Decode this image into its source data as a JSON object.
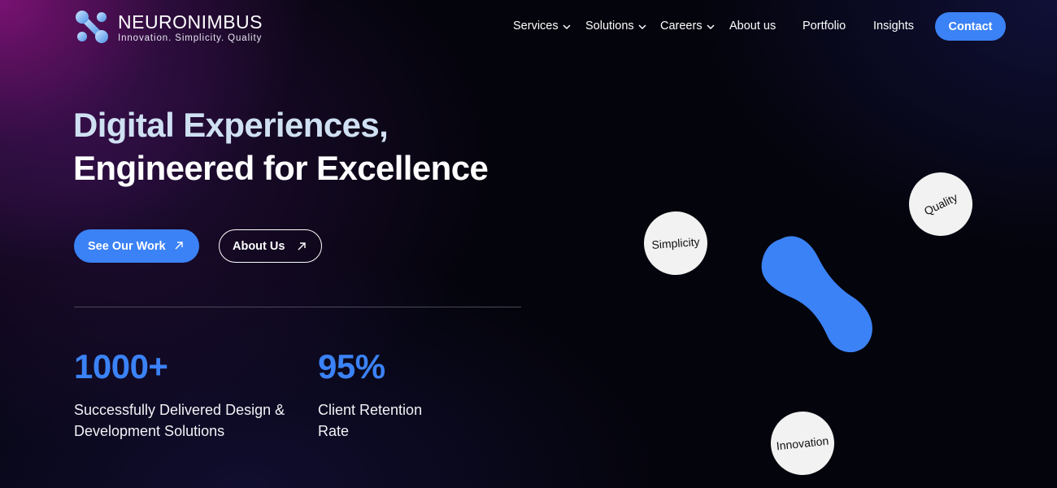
{
  "brand": {
    "name": "NEURONIMBUS",
    "tagline": "Innovation. Simplicity. Quality"
  },
  "nav": {
    "items": [
      {
        "label": "Services",
        "icon": "chevron-down-icon"
      },
      {
        "label": "Solutions",
        "icon": "chevron-down-icon"
      },
      {
        "label": "Careers",
        "icon": "chevron-down-icon"
      },
      {
        "label": "About us"
      },
      {
        "label": "Portfolio"
      },
      {
        "label": "Insights"
      }
    ],
    "contact_label": "Contact"
  },
  "hero": {
    "line1": "Digital Experiences,",
    "line2": "Engineered for Excellence",
    "primary_cta": "See Our Work",
    "secondary_cta": "About Us",
    "cta_icon": "arrow-up-right-icon"
  },
  "stats": [
    {
      "value": "1000+",
      "label": "Successfully Delivered Design & Development Solutions"
    },
    {
      "value": "95%",
      "label": "Client Retention Rate"
    }
  ],
  "bubbles": {
    "simplicity": "Simplicity",
    "quality": "Quality",
    "innovation": "Innovation"
  },
  "colors": {
    "accent": "#3b82f6",
    "background": "#04040c",
    "glow": "#8c1482"
  }
}
